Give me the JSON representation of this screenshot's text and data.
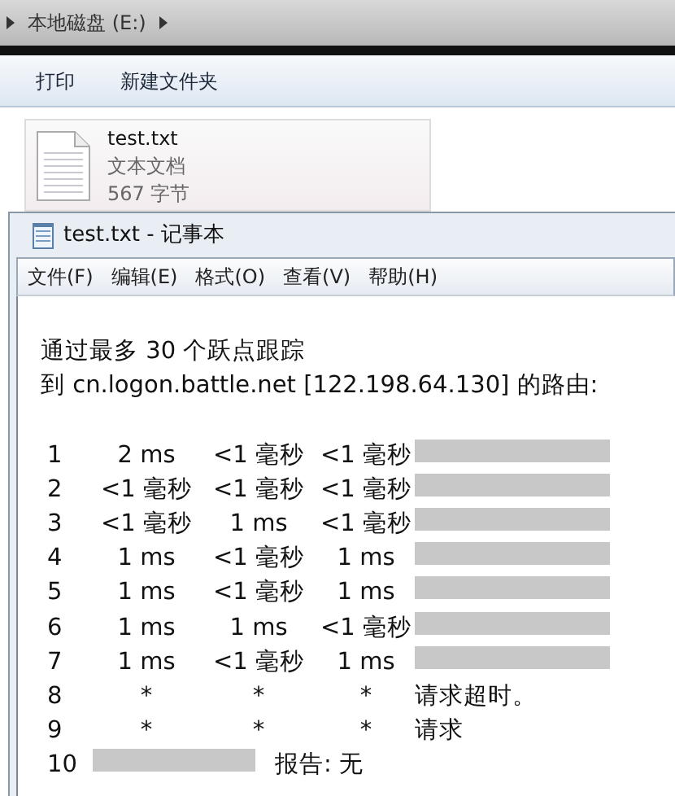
{
  "breadcrumb": {
    "location": "本地磁盘 (E:)"
  },
  "toolbar": {
    "buttons": [
      "打印",
      "新建文件夹"
    ]
  },
  "file": {
    "name": "test.txt",
    "type": "文本文档",
    "size": "567 字节",
    "selected": true
  },
  "notepad": {
    "title": "test.txt - 记事本",
    "menu": [
      "文件(F)",
      "编辑(E)",
      "格式(O)",
      "查看(V)",
      "帮助(H)"
    ],
    "header": [
      "通过最多 30 个跃点跟踪",
      "到 cn.logon.battle.net [122.198.64.130] 的路由:"
    ],
    "hops": [
      {
        "number": "1",
        "times": [
          "2 ms",
          "<1 毫秒",
          "<1 毫秒"
        ],
        "redacted": true
      },
      {
        "number": "2",
        "times": [
          "<1 毫秒",
          "<1 毫秒",
          "<1 毫秒"
        ],
        "redacted": true
      },
      {
        "number": "3",
        "times": [
          "<1 毫秒",
          "1 ms",
          "<1 毫秒"
        ],
        "redacted": true
      },
      {
        "number": "4",
        "times": [
          "1 ms",
          "<1 毫秒",
          "1 ms"
        ],
        "redacted": true
      },
      {
        "number": "5",
        "times": [
          "1 ms",
          "<1 毫秒",
          "1 ms"
        ],
        "redacted": true
      },
      {
        "number": "6",
        "times": [
          "1 ms",
          "1 ms",
          "<1 毫秒"
        ],
        "redacted": true
      },
      {
        "number": "7",
        "times": [
          "1 ms",
          "<1 毫秒",
          "1 ms"
        ],
        "redacted": true
      },
      {
        "number": "8",
        "times": [
          "*",
          "*",
          "*"
        ],
        "redacted": false,
        "message": "请求超时。"
      },
      {
        "number": "9",
        "times": [
          "*",
          "*",
          "*"
        ],
        "redacted": false,
        "message": "请求"
      },
      {
        "number": "10",
        "redacted": true,
        "message": "报告: 无"
      }
    ]
  }
}
